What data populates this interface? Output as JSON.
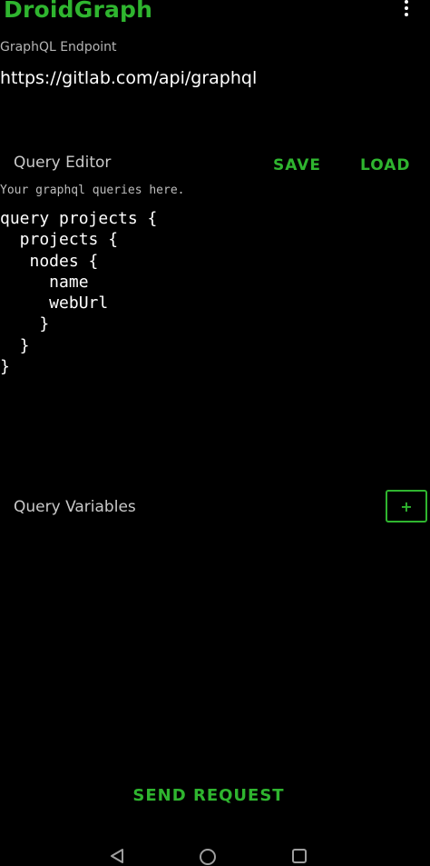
{
  "app": {
    "title": "DroidGraph"
  },
  "endpoint": {
    "label": "GraphQL Endpoint",
    "value": "https://gitlab.com/api/graphql"
  },
  "query_editor": {
    "label": "Query Editor",
    "save_label": "SAVE",
    "load_label": "LOAD",
    "hint": "Your graphql queries here.",
    "value": "query projects {\n  projects {\n   nodes {\n     name\n     webUrl\n    }\n  }\n}"
  },
  "variables": {
    "label": "Query Variables",
    "add_label": "+"
  },
  "actions": {
    "send_label": "SEND REQUEST"
  },
  "icons": {
    "overflow": "more-vert-icon",
    "back": "nav-back-icon",
    "home": "nav-home-icon",
    "recents": "nav-recents-icon"
  },
  "colors": {
    "accent": "#2fb52f",
    "background": "#000000",
    "text": "#ffffff",
    "muted": "#b5b5b5"
  }
}
